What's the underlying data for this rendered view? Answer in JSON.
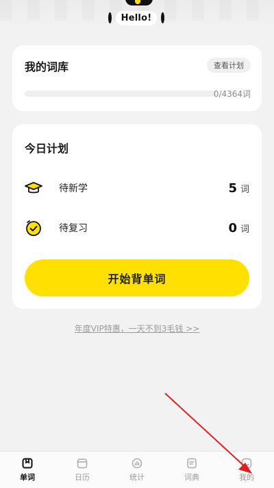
{
  "header": {
    "greeting": "Hello!"
  },
  "library": {
    "title": "我的词库",
    "plan_button": "查看计划",
    "progress_fraction": 0,
    "progress_text": "0/4364词"
  },
  "plan": {
    "title": "今日计划",
    "new_words": {
      "label": "待新学",
      "count": "5",
      "unit": "词"
    },
    "review_words": {
      "label": "待复习",
      "count": "0",
      "unit": "词"
    },
    "start_button": "开始背单词"
  },
  "vip_link": "年度VIP特惠，一天不到3毛钱 >>",
  "nav": {
    "items": [
      {
        "label": "单词",
        "icon": "word-book-icon",
        "active": true
      },
      {
        "label": "日历",
        "icon": "calendar-icon",
        "active": false
      },
      {
        "label": "统计",
        "icon": "stats-icon",
        "active": false
      },
      {
        "label": "词典",
        "icon": "dictionary-icon",
        "active": false
      },
      {
        "label": "我的",
        "icon": "profile-icon",
        "active": false
      }
    ]
  },
  "colors": {
    "accent": "#ffe000",
    "annotation": "#e02020"
  }
}
